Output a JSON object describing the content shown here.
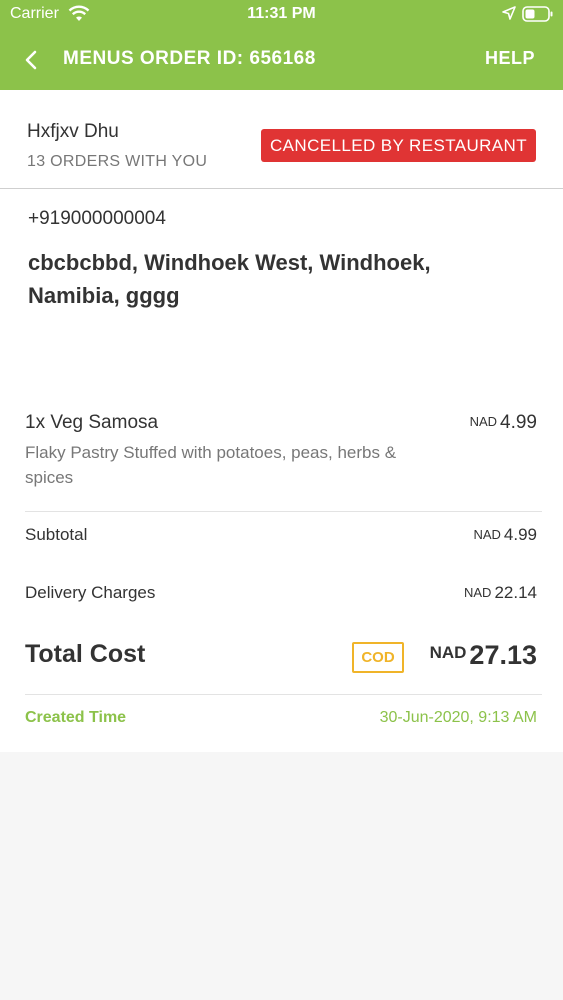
{
  "status_bar": {
    "carrier": "Carrier",
    "time": "11:31 PM",
    "icons": [
      "wifi-icon",
      "location-arrow-icon",
      "battery-icon"
    ]
  },
  "nav": {
    "title": "MENUS ORDER ID: 656168",
    "help_label": "HELP",
    "back_icon": "chevron-left-icon"
  },
  "customer": {
    "name": "Hxfjxv Dhu",
    "order_count": "13 ORDERS WITH YOU",
    "status": "CANCELLED BY RESTAURANT",
    "phone": "+919000000004",
    "address": "cbcbcbbd, Windhoek West, Windhoek, Namibia, gggg"
  },
  "items": [
    {
      "name": "1x Veg Samosa",
      "description": "Flaky Pastry Stuffed with potatoes, peas, herbs & spices",
      "currency": "NAD",
      "price": "4.99"
    }
  ],
  "summary": {
    "subtotal_label": "Subtotal",
    "subtotal_currency": "NAD",
    "subtotal_value": "4.99",
    "delivery_label": "Delivery Charges",
    "delivery_currency": "NAD",
    "delivery_value": "22.14",
    "total_label": "Total Cost",
    "payment_method": "COD",
    "total_currency": "NAD",
    "total_value": "27.13"
  },
  "created": {
    "label": "Created Time",
    "value": "30-Jun-2020, 9:13 AM"
  },
  "colors": {
    "header": "#8cc24a",
    "status_badge": "#e03434",
    "cod_badge": "#f0b429",
    "created_text": "#8cc24a"
  }
}
